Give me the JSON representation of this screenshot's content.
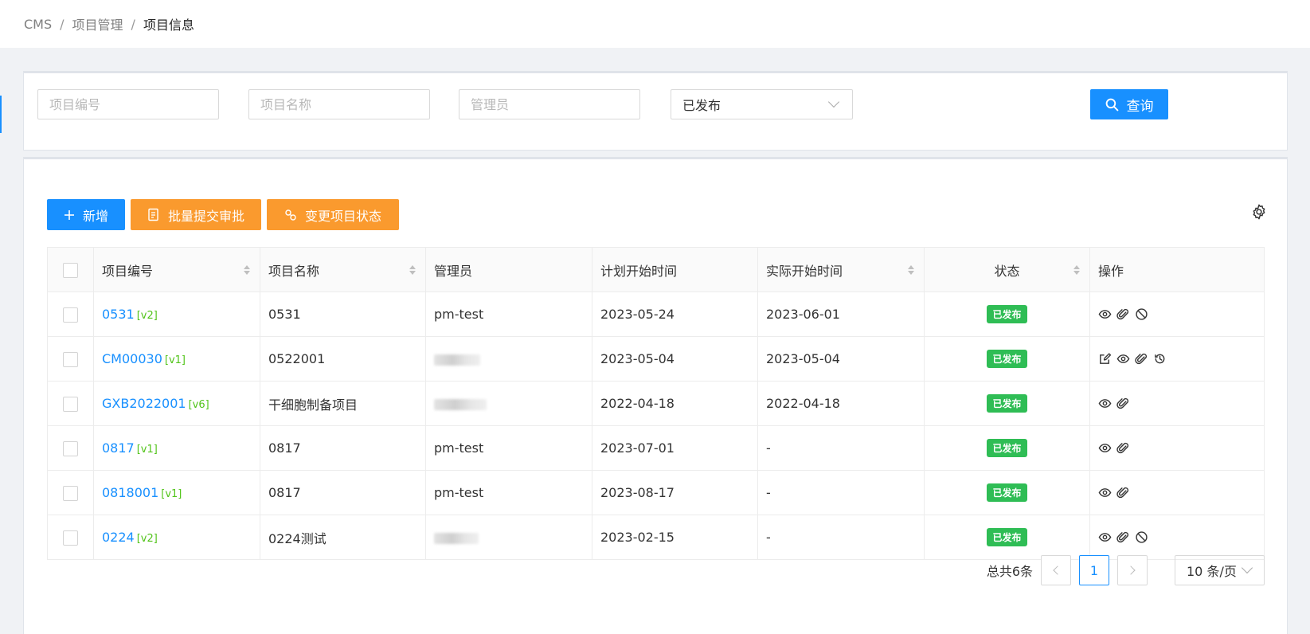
{
  "breadcrumb": [
    "CMS",
    "项目管理",
    "项目信息"
  ],
  "search": {
    "code_placeholder": "项目编号",
    "name_placeholder": "项目名称",
    "manager_placeholder": "管理员",
    "status_value": "已发布",
    "query_label": "查询"
  },
  "toolbar": {
    "add_label": "新增",
    "batch_submit_label": "批量提交审批",
    "change_status_label": "变更项目状态"
  },
  "table": {
    "headers": {
      "code": "项目编号",
      "name": "项目名称",
      "manager": "管理员",
      "planned_start": "计划开始时间",
      "actual_start": "实际开始时间",
      "status": "状态",
      "actions": "操作"
    },
    "rows": [
      {
        "code": "0531",
        "version": "[v2]",
        "name": "0531",
        "manager": "pm-test",
        "planned_start": "2023-05-24",
        "actual_start": "2023-06-01",
        "status": "已发布",
        "actions": [
          "view-icon",
          "attachment-icon",
          "disable-icon"
        ]
      },
      {
        "code": "CM00030",
        "version": "[v1]",
        "name": "0522001",
        "manager": "",
        "planned_start": "2023-05-04",
        "actual_start": "2023-05-04",
        "status": "已发布",
        "actions": [
          "edit-icon",
          "view-icon",
          "attachment-icon",
          "history-icon"
        ]
      },
      {
        "code": "GXB2022001",
        "version": "[v6]",
        "name": "干细胞制备项目",
        "manager": "",
        "planned_start": "2022-04-18",
        "actual_start": "2022-04-18",
        "status": "已发布",
        "actions": [
          "view-icon",
          "attachment-icon"
        ]
      },
      {
        "code": "0817",
        "version": "[v1]",
        "name": "0817",
        "manager": "pm-test",
        "planned_start": "2023-07-01",
        "actual_start": "-",
        "status": "已发布",
        "actions": [
          "view-icon",
          "attachment-icon"
        ]
      },
      {
        "code": "0818001",
        "version": "[v1]",
        "name": "0817",
        "manager": "pm-test",
        "planned_start": "2023-08-17",
        "actual_start": "-",
        "status": "已发布",
        "actions": [
          "view-icon",
          "attachment-icon"
        ]
      },
      {
        "code": "0224",
        "version": "[v2]",
        "name": "0224测试",
        "manager": "",
        "planned_start": "2023-02-15",
        "actual_start": "-",
        "status": "已发布",
        "actions": [
          "view-icon",
          "attachment-icon",
          "disable-icon"
        ]
      }
    ]
  },
  "pagination": {
    "total_label": "总共6条",
    "current_page": "1",
    "page_size_label": "10 条/页"
  },
  "colors": {
    "primary": "#1890ff",
    "warning": "#fa9a2e",
    "success": "#2fbd55",
    "version": "#52c41a"
  }
}
